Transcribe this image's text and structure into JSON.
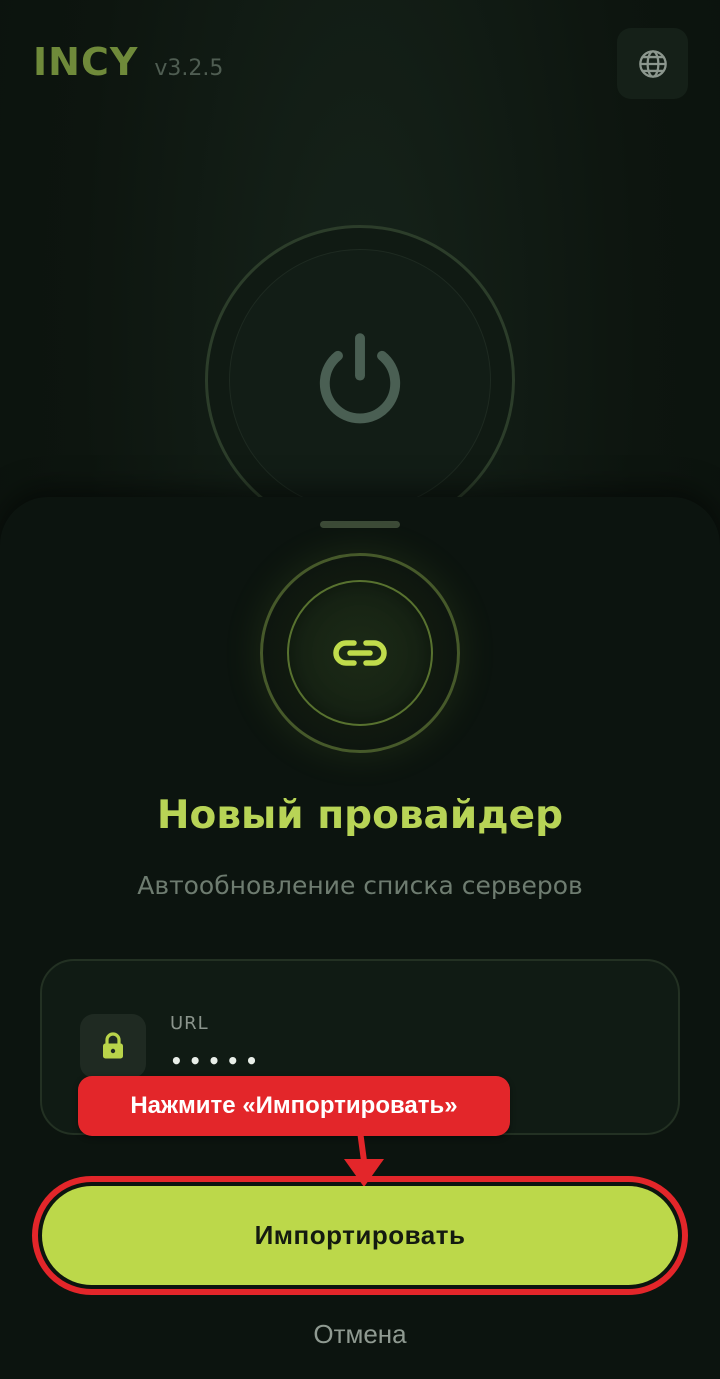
{
  "header": {
    "app_name": "INCY",
    "version": "v3.2.5",
    "language_icon": "globe-icon"
  },
  "background": {
    "power_icon": "power-icon"
  },
  "sheet": {
    "link_icon": "link-icon",
    "title": "Новый провайдер",
    "subtitle": "Автообновление списка серверов",
    "url_field": {
      "icon": "lock-icon",
      "label": "URL",
      "value": "•••••"
    },
    "callout_text": "Нажмите «Импортировать»",
    "import_label": "Импортировать",
    "cancel_label": "Отмена"
  },
  "colors": {
    "accent": "#bcd84a",
    "title": "#b8d456",
    "annotation_red": "#e3262a",
    "background": "#0c140f"
  }
}
